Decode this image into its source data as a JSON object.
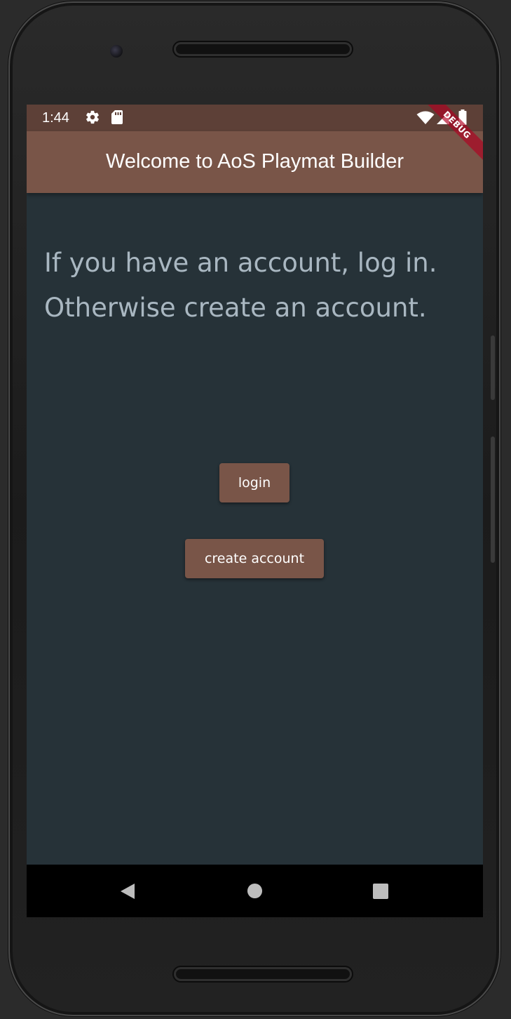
{
  "status_bar": {
    "time": "1:44",
    "icons": [
      "gear-icon",
      "sd-card-icon",
      "wifi-icon",
      "signal-icon",
      "battery-icon"
    ],
    "color": "#5d4037"
  },
  "app_bar": {
    "title": "Welcome to AoS Playmat Builder",
    "color": "#795548",
    "debug_banner": "DEBUG"
  },
  "content": {
    "prompt": "If you have an account, log in. Otherwise create an account.",
    "background": "#263238",
    "text_color": "#a9b7c1"
  },
  "buttons": {
    "login_label": "login",
    "create_account_label": "create account",
    "color": "#795548"
  },
  "nav_bar": {
    "icons": [
      "back-triangle-icon",
      "home-circle-icon",
      "recents-square-icon"
    ]
  }
}
